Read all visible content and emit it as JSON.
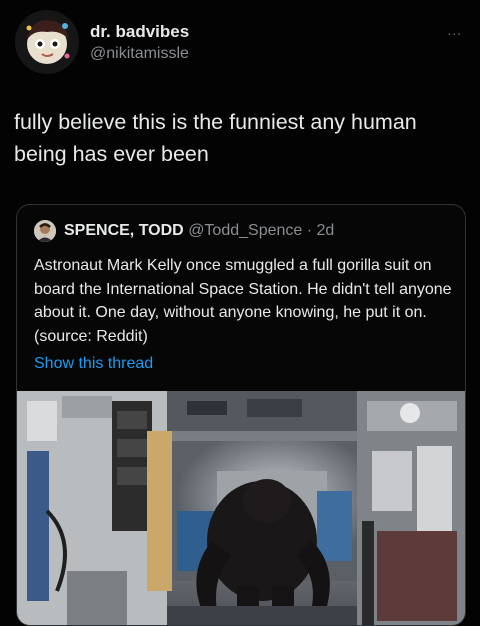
{
  "author": {
    "display_name": "dr. badvibes",
    "handle": "@nikitamissle",
    "avatar_icon": "cartoon-avatar-icon",
    "more_label": "..."
  },
  "tweet": {
    "text": "fully believe this is the funniest any human being has ever been"
  },
  "quoted_tweet": {
    "avatar_icon": "profile-avatar-icon",
    "display_name": "SPENCE, TODD",
    "handle": "@Todd_Spence",
    "separator": "·",
    "age": "2d",
    "text": "Astronaut Mark Kelly once smuggled a full gorilla suit on board the International Space Station. He didn't tell anyone about it. One day, without anyone knowing, he put it on. (source: Reddit)",
    "show_thread_label": "Show this thread",
    "media_description_icon": "space-station-video-still"
  },
  "colors": {
    "background": "#030303",
    "text": "#e7e9ea",
    "muted": "#8a8d91",
    "link": "#1d9bf0",
    "border": "#2f3336"
  }
}
